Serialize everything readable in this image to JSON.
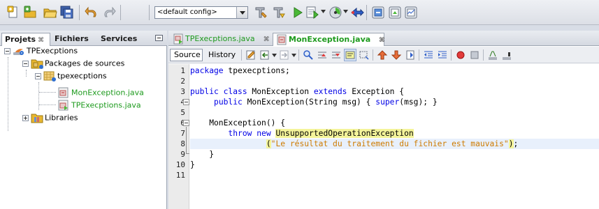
{
  "toolbar": {
    "buttons": [
      {
        "name": "new-file-icon"
      },
      {
        "name": "new-project-icon"
      },
      {
        "name": "open-project-icon"
      },
      {
        "name": "save-all-icon"
      },
      {
        "name": "undo-icon"
      },
      {
        "name": "redo-icon"
      },
      {
        "name": "clean-build-icon"
      },
      {
        "name": "build-icon"
      },
      {
        "name": "run-icon"
      },
      {
        "name": "debug-icon"
      },
      {
        "name": "profile-icon"
      },
      {
        "name": "apply-code-changes-icon"
      },
      {
        "name": "gc-icon"
      },
      {
        "name": "snapshot-icon"
      },
      {
        "name": "memory-icon"
      }
    ],
    "config_value": "<default config>"
  },
  "left_panel": {
    "tabs": [
      {
        "label": "Projets",
        "close": "⌘"
      },
      {
        "label": "Fichiers",
        "close": ""
      },
      {
        "label": "Services",
        "close": ""
      }
    ],
    "tree": {
      "project": "TPExecptions",
      "source_packages": "Packages de sources",
      "package": "tpexecptions",
      "files": [
        "MonException.java",
        "TPExecptions.java"
      ],
      "libraries": "Libraries"
    }
  },
  "editor": {
    "tabs": [
      {
        "label": "TPExecptions.java",
        "close": "⌘"
      },
      {
        "label": "MonException.java",
        "close": "⌘"
      }
    ],
    "view_tabs": {
      "source": "Source",
      "history": "History"
    },
    "line_numbers": [
      "1",
      "2",
      "3",
      "4",
      "5",
      "6",
      "7",
      "8",
      "9",
      "10",
      "11"
    ],
    "code": {
      "l1_kw": "package",
      "l1_rest": " tpexecptions;",
      "l3_kw1": "public class",
      "l3_name": " MonException ",
      "l3_kw2": "extends",
      "l3_rest": " Exception {",
      "l4_indent": "     ",
      "l4_kw": "public",
      "l4_sig": " MonException(String msg) { ",
      "l4_super": "super",
      "l4_end": "(msg); }",
      "l6_text": "    MonException() {",
      "l7_indent": "        ",
      "l7_kw": "throw new",
      "l7_sp": " ",
      "l7_class": "UnsupportedOperationException",
      "l8_indent": "                ",
      "l8_open": "(",
      "l8_str": "\"Le résultat du traitement du fichier est mauvais\"",
      "l8_close": ")",
      "l8_semi": ";",
      "l9_text": "    }",
      "l10_text": "}"
    }
  },
  "colors": {
    "keyword": "#0000e6",
    "string": "#ce7b00",
    "match_highlight": "#f4f49a",
    "current_line": "#e8f0fc",
    "project_file_green": "#1d9a1d"
  }
}
